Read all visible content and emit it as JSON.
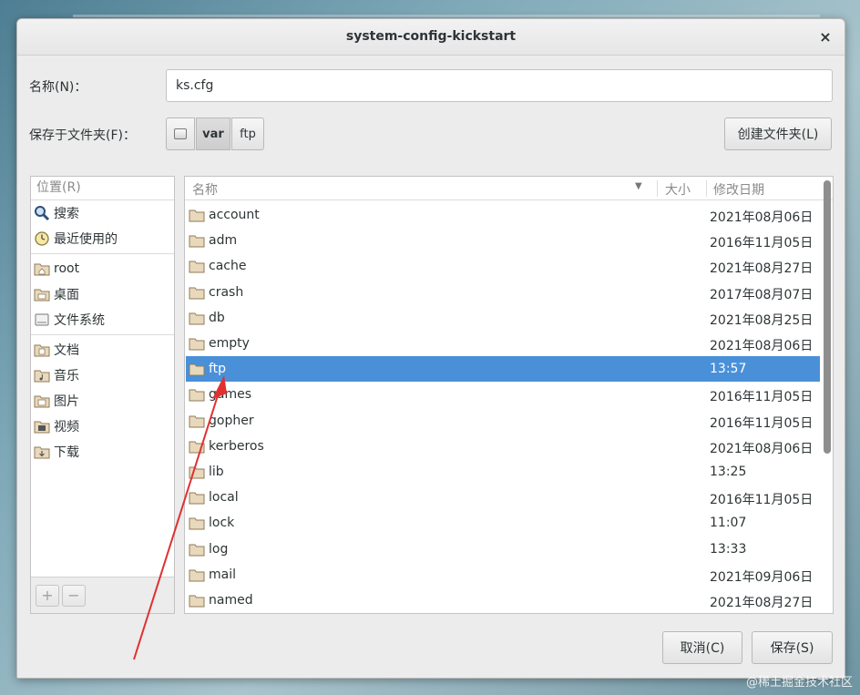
{
  "window": {
    "title": "system-config-kickstart",
    "close": "×"
  },
  "form": {
    "name_label": "名称(N)：",
    "name_value": "ks.cfg",
    "save_in_label": "保存于文件夹(F)：",
    "path": [
      "var",
      "ftp"
    ],
    "create_folder": "创建文件夹(L)"
  },
  "places": {
    "header": "位置(R)",
    "items": [
      {
        "label": "搜索",
        "icon": "search-icon"
      },
      {
        "label": "最近使用的",
        "icon": "recent-icon"
      },
      {
        "label": "root",
        "icon": "home-folder-icon"
      },
      {
        "label": "桌面",
        "icon": "desktop-folder-icon"
      },
      {
        "label": "文件系统",
        "icon": "drive-icon"
      },
      {
        "label": "文档",
        "icon": "documents-folder-icon"
      },
      {
        "label": "音乐",
        "icon": "music-folder-icon"
      },
      {
        "label": "图片",
        "icon": "pictures-folder-icon"
      },
      {
        "label": "视频",
        "icon": "videos-folder-icon"
      },
      {
        "label": "下载",
        "icon": "downloads-folder-icon"
      }
    ],
    "add": "+",
    "remove": "−"
  },
  "files": {
    "col_name": "名称",
    "col_size": "大小",
    "col_date": "修改日期",
    "rows": [
      {
        "name": "account",
        "date": "2021年08月06日"
      },
      {
        "name": "adm",
        "date": "2016年11月05日"
      },
      {
        "name": "cache",
        "date": "2021年08月27日"
      },
      {
        "name": "crash",
        "date": "2017年08月07日"
      },
      {
        "name": "db",
        "date": "2021年08月25日"
      },
      {
        "name": "empty",
        "date": "2021年08月06日"
      },
      {
        "name": "ftp",
        "date": "13:57"
      },
      {
        "name": "games",
        "date": "2016年11月05日"
      },
      {
        "name": "gopher",
        "date": "2016年11月05日"
      },
      {
        "name": "kerberos",
        "date": "2021年08月06日"
      },
      {
        "name": "lib",
        "date": "13:25"
      },
      {
        "name": "local",
        "date": "2016年11月05日"
      },
      {
        "name": "lock",
        "date": "11:07"
      },
      {
        "name": "log",
        "date": "13:33"
      },
      {
        "name": "mail",
        "date": "2021年09月06日"
      },
      {
        "name": "named",
        "date": "2021年08月27日"
      }
    ],
    "selected_index": 6
  },
  "buttons": {
    "cancel": "取消(C)",
    "save": "保存(S)"
  },
  "watermark": "@稀土掘金技术社区",
  "colors": {
    "selection": "#4a90d9",
    "annotation_arrow": "#e03030"
  }
}
